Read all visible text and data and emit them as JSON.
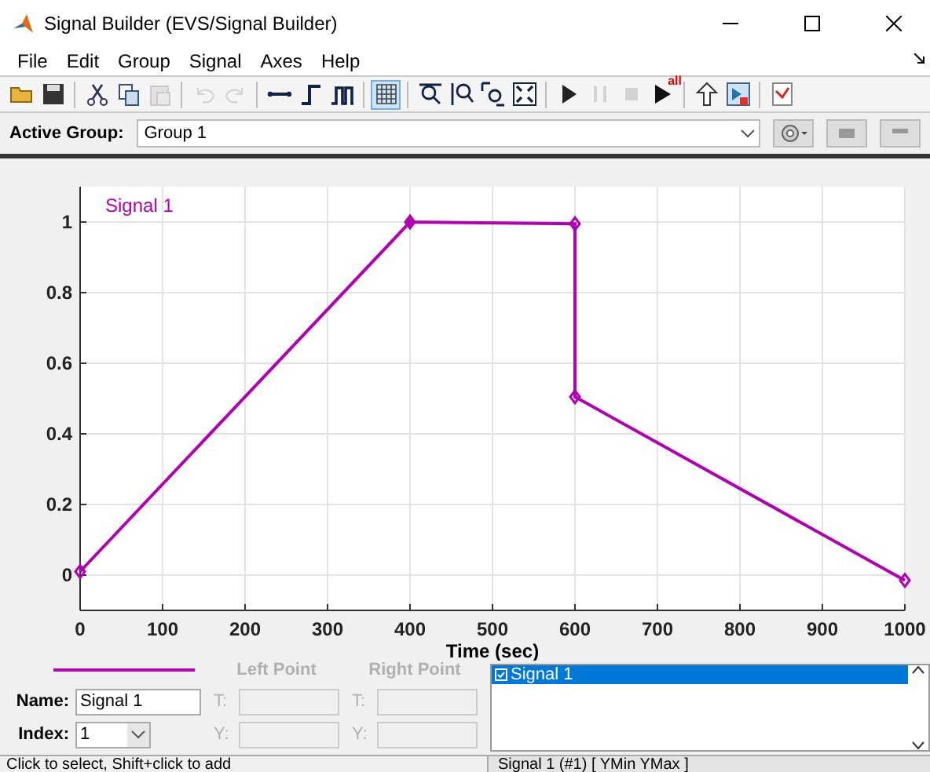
{
  "window": {
    "title": "Signal Builder (EVS/Signal Builder)"
  },
  "menu": [
    "File",
    "Edit",
    "Group",
    "Signal",
    "Axes",
    "Help"
  ],
  "toolbar": [
    {
      "kind": "open",
      "disabled": false,
      "on": false
    },
    {
      "kind": "save",
      "disabled": false,
      "on": false
    },
    {
      "kind": "separator"
    },
    {
      "kind": "cut",
      "disabled": false,
      "on": false
    },
    {
      "kind": "copy",
      "disabled": false,
      "on": false
    },
    {
      "kind": "paste",
      "disabled": true,
      "on": false
    },
    {
      "kind": "separator"
    },
    {
      "kind": "undo",
      "disabled": true,
      "on": false
    },
    {
      "kind": "redo",
      "disabled": true,
      "on": false
    },
    {
      "kind": "separator"
    },
    {
      "kind": "segment",
      "disabled": false,
      "on": false
    },
    {
      "kind": "step",
      "disabled": false,
      "on": false
    },
    {
      "kind": "pulse",
      "disabled": false,
      "on": false
    },
    {
      "kind": "separator"
    },
    {
      "kind": "grid",
      "disabled": false,
      "on": true
    },
    {
      "kind": "separator"
    },
    {
      "kind": "zoomx",
      "disabled": false,
      "on": false
    },
    {
      "kind": "zoomy",
      "disabled": false,
      "on": false
    },
    {
      "kind": "zoombox",
      "disabled": false,
      "on": false
    },
    {
      "kind": "fit",
      "disabled": false,
      "on": false
    },
    {
      "kind": "separator"
    },
    {
      "kind": "play",
      "disabled": false,
      "on": false
    },
    {
      "kind": "pause",
      "disabled": true,
      "on": false
    },
    {
      "kind": "stop",
      "disabled": true,
      "on": false
    },
    {
      "kind": "playall",
      "disabled": false,
      "on": false,
      "badge": "all"
    },
    {
      "kind": "separator"
    },
    {
      "kind": "up",
      "disabled": false,
      "on": false
    },
    {
      "kind": "export",
      "disabled": false,
      "on": false
    },
    {
      "kind": "separator"
    },
    {
      "kind": "check",
      "disabled": false,
      "on": false
    }
  ],
  "active_group": {
    "label": "Active Group:",
    "value": "Group 1"
  },
  "chart_data": {
    "type": "line",
    "grid": true,
    "xlabel": "Time (sec)",
    "xlim": [
      0,
      1000
    ],
    "ylim": [
      -0.1,
      1.1
    ],
    "xticks": [
      0,
      100,
      200,
      300,
      400,
      500,
      600,
      700,
      800,
      900,
      1000
    ],
    "yticks": [
      0,
      0.2,
      0.4,
      0.6,
      0.8,
      1
    ],
    "x": [
      0,
      400,
      600,
      600,
      1000
    ],
    "series": [
      {
        "name": "Signal 1",
        "color": "#b400b4",
        "marker": "diamond",
        "values": [
          0.01,
          1,
          0.995,
          0.505,
          -0.015
        ]
      }
    ]
  },
  "editor": {
    "name_label": "Name:",
    "name": "Signal 1",
    "index_label": "Index:",
    "index": "1",
    "left_point": {
      "title": "Left Point",
      "disabled": true,
      "t_label": "T:",
      "y_label": "Y:"
    },
    "right_point": {
      "title": "Right Point",
      "disabled": true,
      "t_label": "T:",
      "y_label": "Y:"
    }
  },
  "signals": [
    {
      "label": "Signal 1",
      "checked": true,
      "selected": true
    }
  ],
  "status_bar": {
    "hint": "Click to select, Shift+click to add",
    "signal": "Signal 1 (#1)  [ YMin YMax ]"
  }
}
